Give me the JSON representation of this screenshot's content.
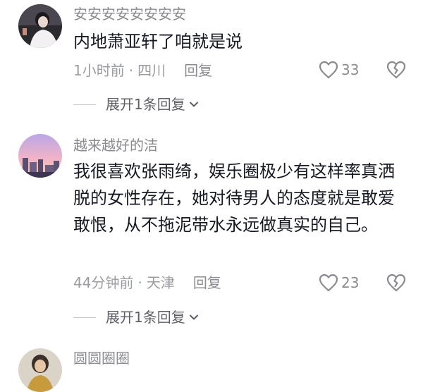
{
  "comments": [
    {
      "username": "安安安安安安安安",
      "text": "内地萧亚轩了咱就是说",
      "time": "1小时前",
      "location": "四川",
      "reply_label": "回复",
      "likes": "33",
      "expand_label": "展开1条回复"
    },
    {
      "username": "越来越好的洁",
      "text": "我很喜欢张雨绮，娱乐圈极少有这样率真洒脱的女性存在，她对待男人的态度就是敢爱敢恨，从不拖泥带水永远做真实的自己。",
      "time": "44分钟前",
      "location": "天津",
      "reply_label": "回复",
      "likes": "23",
      "expand_label": "展开1条回复"
    },
    {
      "username": "圆圆圈圈"
    }
  ],
  "separator": "·",
  "icons": {
    "like": "heart-outline-icon",
    "dislike": "broken-heart-icon",
    "expand": "chevron-down-icon"
  }
}
